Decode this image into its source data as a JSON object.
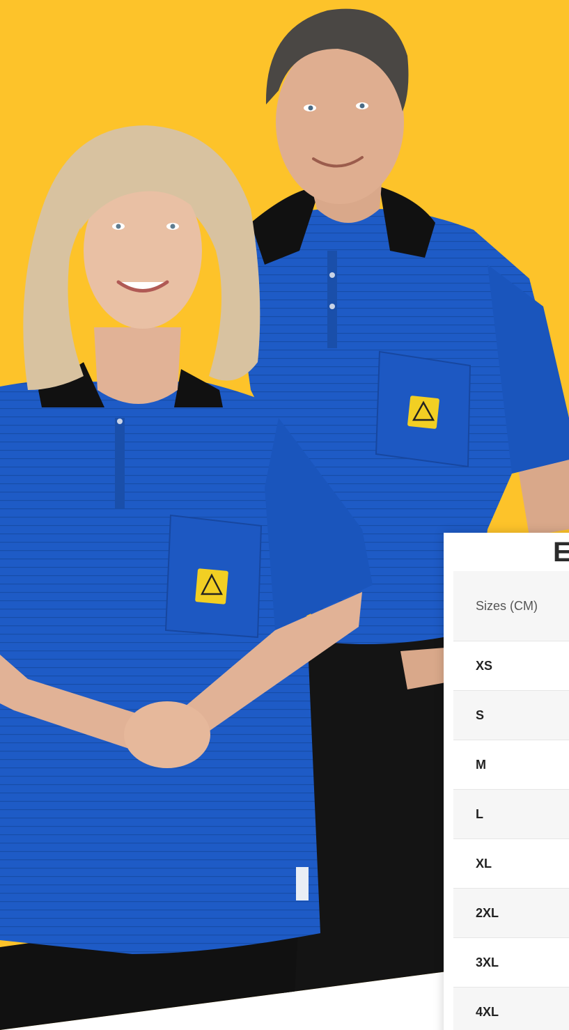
{
  "colors": {
    "background": "#FDC32A",
    "shirt": "#1E5BC6",
    "collar": "#111111",
    "esd_badge": "#F2CF23",
    "card": "#FFFFFF",
    "row_alt": "#F6F6F6"
  },
  "size_chart": {
    "title_fragment": "E",
    "header": "Sizes (CM)",
    "sizes": [
      "XS",
      "S",
      "M",
      "L",
      "XL",
      "2XL",
      "3XL",
      "4XL"
    ]
  }
}
